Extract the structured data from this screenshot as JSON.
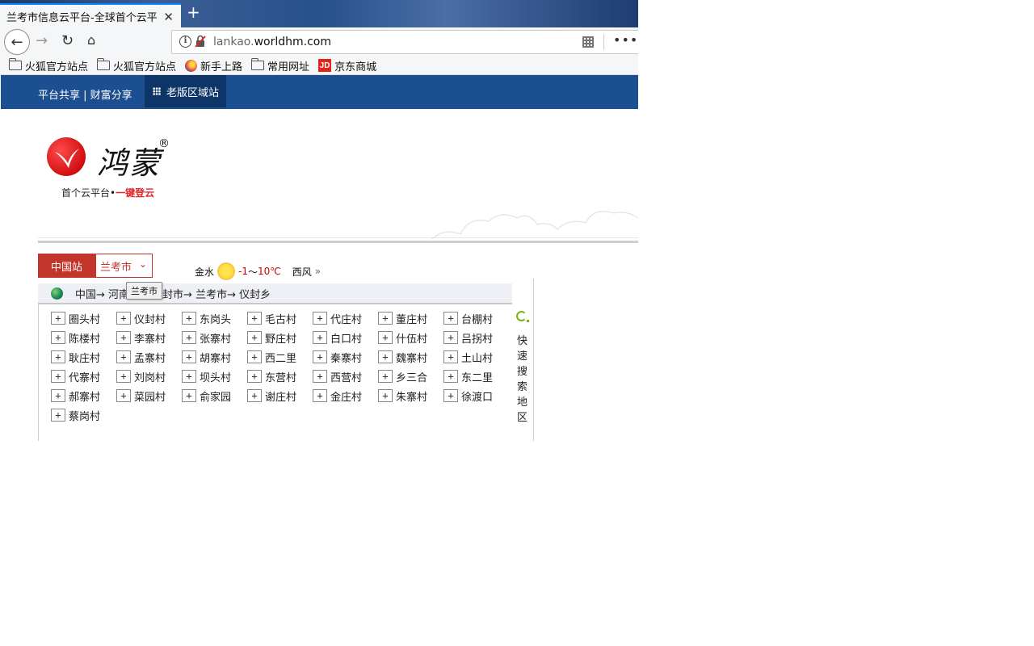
{
  "browser": {
    "tab_title": "兰考市信息云平台-全球首个云平台",
    "tab_close": "✕",
    "newtab": "+",
    "url_host_prefix": "lankao.",
    "url_host_main": "worldhm.com",
    "bookmarks": [
      {
        "label": "火狐官方站点",
        "icon": "folder-icon"
      },
      {
        "label": "火狐官方站点",
        "icon": "folder-icon"
      },
      {
        "label": "新手上路",
        "icon": "firefox-icon"
      },
      {
        "label": "常用网址",
        "icon": "folder-icon"
      },
      {
        "label": "京东商城",
        "icon": "jd-icon",
        "icon_text": "JD"
      }
    ]
  },
  "site": {
    "topbar_links": "平台共享 | 财富分享",
    "topbar_active": "老版区域站",
    "logo_calligraphy": "鸿蒙",
    "logo_reg": "®",
    "slogan_prefix": "首个云平台•",
    "slogan_accent": "一键登云",
    "station_label": "中国站",
    "city_select": "兰考市",
    "weather": {
      "place": "金水",
      "temp_low": "-1",
      "sep": "～",
      "temp_high": "10℃",
      "wind": "西风",
      "more": "»"
    },
    "path": "中国→ 河南省→ 开封市→ 兰考市→ 仪封乡",
    "tooltip": "兰考市",
    "villages": [
      "圈头村",
      "仪封村",
      "东岗头",
      "毛古村",
      "代庄村",
      "董庄村",
      "台棚村",
      "陈楼村",
      "李寨村",
      "张寨村",
      "野庄村",
      "白口村",
      "什伍村",
      "吕拐村",
      "耿庄村",
      "孟寨村",
      "胡寨村",
      "西二里",
      "秦寨村",
      "魏寨村",
      "土山村",
      "代寨村",
      "刘岗村",
      "坝头村",
      "东营村",
      "西营村",
      "乡三合",
      "东二里",
      "郝寨村",
      "菜园村",
      "俞家园",
      "谢庄村",
      "金庄村",
      "朱寨村",
      "徐渡口",
      "蔡岗村"
    ],
    "quick_search": "快速搜索地区"
  },
  "colors": {
    "brand_blue": "#1c4f91",
    "station_red": "#c3352b",
    "accent_red": "#e0262b"
  }
}
